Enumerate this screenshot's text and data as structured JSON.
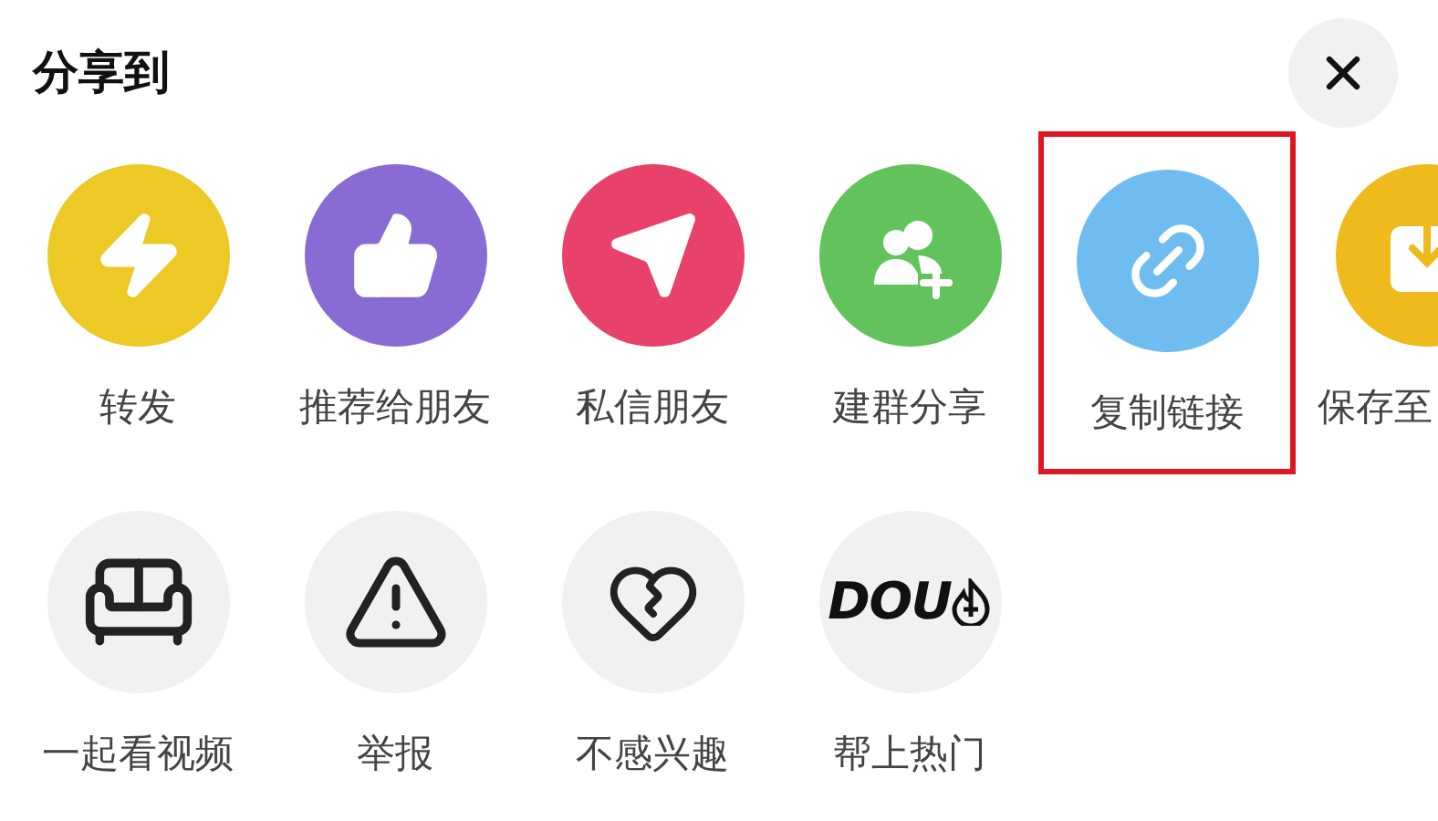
{
  "title": "分享到",
  "share_targets": [
    {
      "kind": "repost",
      "label": "转发",
      "color": "#ecc925",
      "highlighted": false,
      "cut_off": false
    },
    {
      "kind": "recommend",
      "label": "推荐给朋友",
      "color": "#8a6ad3",
      "highlighted": false,
      "cut_off": false
    },
    {
      "kind": "message",
      "label": "私信朋友",
      "color": "#e8416a",
      "highlighted": false,
      "cut_off": false
    },
    {
      "kind": "group",
      "label": "建群分享",
      "color": "#62c25b",
      "highlighted": false,
      "cut_off": false
    },
    {
      "kind": "link",
      "label": "复制链接",
      "color": "#6fbdf0",
      "highlighted": true,
      "cut_off": false
    },
    {
      "kind": "save",
      "label": "保存至",
      "color": "#efba1c",
      "highlighted": false,
      "cut_off": true
    }
  ],
  "actions": [
    {
      "kind": "watch",
      "label": "一起看视频"
    },
    {
      "kind": "report",
      "label": "举报"
    },
    {
      "kind": "dislike",
      "label": "不感兴趣"
    },
    {
      "kind": "promote",
      "label": "帮上热门",
      "logo_text": "DOU"
    }
  ]
}
